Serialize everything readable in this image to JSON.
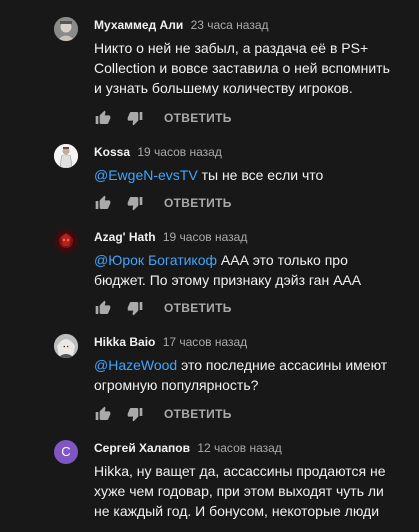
{
  "comments": [
    {
      "author": "Мухаммед Али",
      "time": "23 часа назад",
      "text": "Никто о ней не забыл, а раздача её в PS+ Collection и вовсе заставила о ней вспомнить и узнать большему количеству игроков.",
      "avatar_icon": "photo-avatar-man"
    },
    {
      "author": "Kossa",
      "time": "19 часов назад",
      "mention": "@EwgeN-evsTV",
      "text": " ты не все если что",
      "avatar_icon": "photo-avatar-figure"
    },
    {
      "author": "Azag' Hath",
      "time": "19 часов назад",
      "mention": "@Юрок Богатикоф",
      "text": " ААА это только про бюджет. По этому признаку дэйз ган ААА",
      "avatar_icon": "photo-avatar-red"
    },
    {
      "author": "Hikka Baio",
      "time": "17 часов назад",
      "mention": "@HazeWood",
      "text": " это последние ассасины имеют огромную популярность?",
      "avatar_icon": "photo-avatar-anime"
    },
    {
      "author": "Сергей Халапов",
      "time": "12 часов назад",
      "text": "Hikka, ну ващет да, ассассины продаются не хуже чем годовар, при этом выходят чуть ли не каждый год. И бонусом, некоторые люди",
      "avatar_letter": "С",
      "avatar_color": "#7e57c2"
    }
  ],
  "reply_label": "ОТВЕТИТЬ",
  "colors": {
    "background": "#181818",
    "text": "#f1f1f1",
    "secondary": "#aaaaaa",
    "link": "#3ea6ff"
  }
}
